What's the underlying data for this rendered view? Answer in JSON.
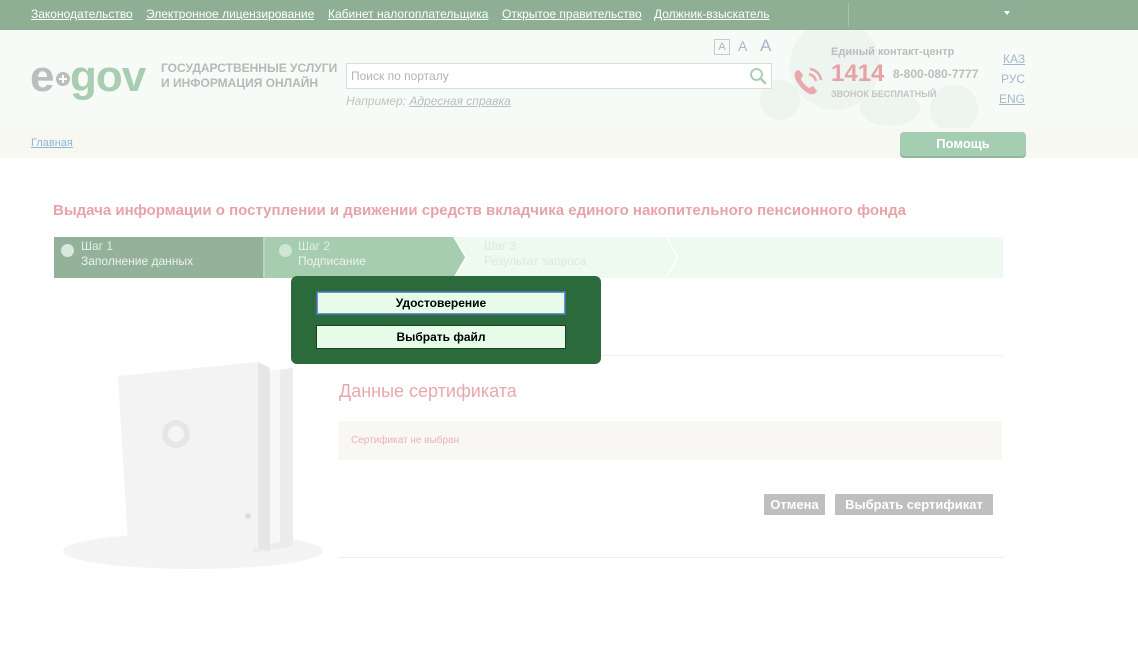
{
  "topnav": {
    "links": [
      "Законодательство",
      "Электронное лицензирование",
      "Кабинет налогоплательщика",
      "Открытое правительство",
      "Должник-взыскатель"
    ]
  },
  "header": {
    "logo": {
      "e": "e",
      "gov": "gov"
    },
    "site_title_line1": "ГОСУДАРСТВЕННЫЕ УСЛУГИ",
    "site_title_line2": "И ИНФОРМАЦИЯ ОНЛАЙН",
    "font_sizes": [
      "A",
      "A",
      "A"
    ],
    "search": {
      "placeholder": "Поиск по порталу",
      "value": ""
    },
    "example_prefix": "Например: ",
    "example_link": "Адресная справка",
    "contact": {
      "label": "Единый контакт-центр",
      "number": "1414",
      "phone": "8-800-080-7777",
      "free": "ЗВОНОК БЕСПЛАТНЫЙ"
    },
    "languages": [
      "КАЗ",
      "РУС",
      "ENG"
    ]
  },
  "breadcrumb": {
    "home": "Главная"
  },
  "help_button": "Помощь",
  "page": {
    "title": "Выдача информации о поступлении и движении средств вкладчика единого накопительного пенсионного фонда",
    "steps": [
      {
        "num": "Шаг 1",
        "desc": "Заполнение данных",
        "state": "done"
      },
      {
        "num": "Шаг 2",
        "desc": "Подписание",
        "state": "active"
      },
      {
        "num": "Шаг 3",
        "desc": "Результат запроса",
        "state": "pending"
      }
    ],
    "cert_title": "Данные сертификата",
    "cert_status": "Сертификат не выбран",
    "cancel_button": "Отмена",
    "select_cert_button": "Выбрать сертификат"
  },
  "popup": {
    "option_id": "Удостоверение",
    "option_file": "Выбрать файл"
  },
  "colors": {
    "topbar": "#8eaf93",
    "accent_pink": "#e6a4a8",
    "popup_bg": "#2b6a3b",
    "popup_button": "#e6fce8"
  }
}
